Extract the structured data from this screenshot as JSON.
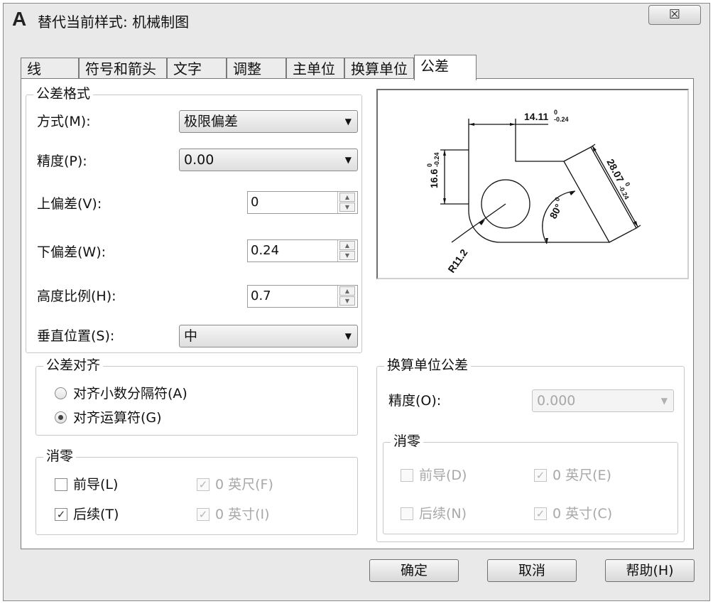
{
  "window": {
    "title": "替代当前样式: 机械制图",
    "close_glyph": "☒"
  },
  "tabs": [
    {
      "label": "线"
    },
    {
      "label": "符号和箭头"
    },
    {
      "label": "文字"
    },
    {
      "label": "调整"
    },
    {
      "label": "主单位"
    },
    {
      "label": "换算单位"
    },
    {
      "label": "公差",
      "active": true
    }
  ],
  "tolerance_format": {
    "title": "公差格式",
    "method_label": "方式(M):",
    "method_value": "极限偏差",
    "precision_label": "精度(P):",
    "precision_value": "0.00",
    "upper_label": "上偏差(V):",
    "upper_value": "0",
    "lower_label": "下偏差(W):",
    "lower_value": "0.24",
    "height_label": "高度比例(H):",
    "height_value": "0.7",
    "vertical_label": "垂直位置(S):",
    "vertical_value": "中"
  },
  "tolerance_align": {
    "title": "公差对齐",
    "options": [
      {
        "label": "对齐小数分隔符(A)",
        "selected": false
      },
      {
        "label": "对齐运算符(G)",
        "selected": true
      }
    ]
  },
  "zero_suppression": {
    "title": "消零",
    "leading_label": "前导(L)",
    "leading_checked": false,
    "trailing_label": "后续(T)",
    "trailing_checked": true,
    "feet_label": "0 英尺(F)",
    "feet_checked": true,
    "inches_label": "0 英寸(I)",
    "inches_checked": true
  },
  "alt_units": {
    "title": "换算单位公差",
    "precision_label": "精度(O):",
    "precision_value": "0.000",
    "zero_title": "消零",
    "leading_label": "前导(D)",
    "leading_checked": false,
    "trailing_label": "后续(N)",
    "trailing_checked": false,
    "feet_label": "0 英尺(E)",
    "feet_checked": true,
    "inches_label": "0 英寸(C)",
    "inches_checked": true
  },
  "preview": {
    "dim_top": "14.11",
    "dim_top_tol_upper": "0",
    "dim_top_tol_lower": "-0.24",
    "dim_left": "16.6",
    "dim_left_tol_upper": "0",
    "dim_left_tol_lower": "-0.24",
    "dim_right": "28.07",
    "dim_right_tol_upper": "0",
    "dim_right_tol_lower": "-0.24",
    "angle": "80°",
    "angle_tol": "0",
    "radius": "R11.2"
  },
  "buttons": {
    "ok": "确定",
    "cancel": "取消",
    "help": "帮助(H)"
  }
}
